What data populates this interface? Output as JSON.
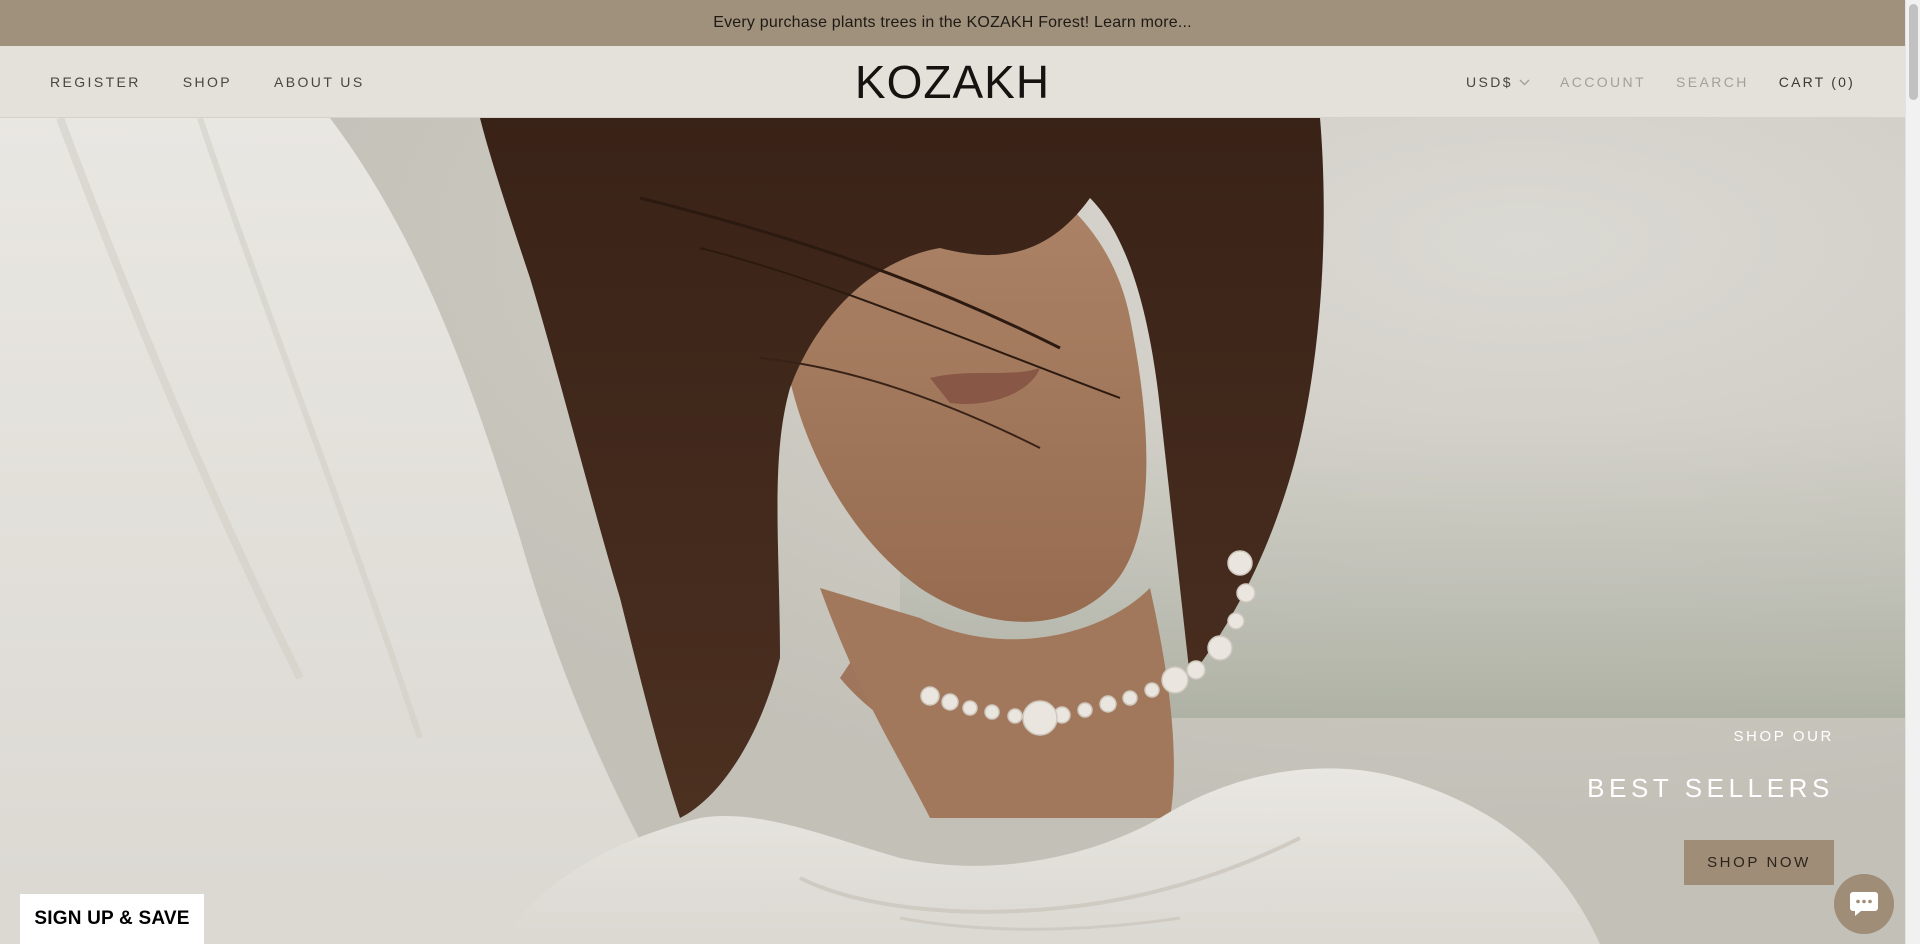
{
  "announcement": {
    "text": "Every purchase plants trees in the KOZAKH Forest! Learn more..."
  },
  "header": {
    "logo": "KOZAKH",
    "nav_left": [
      "REGISTER",
      "SHOP",
      "ABOUT US"
    ],
    "currency": "USD$",
    "account": "ACCOUNT",
    "search": "SEARCH",
    "cart": "CART (0)"
  },
  "hero": {
    "kicker": "SHOP OUR",
    "headline": "BEST SELLERS",
    "cta": "SHOP NOW"
  },
  "signup": {
    "label": "SIGN UP & SAVE"
  },
  "icons": {
    "currency_caret": "chevron-down-icon",
    "chat": "chat-bubble-icon"
  },
  "colors": {
    "announcement_bg": "#a0917c",
    "header_bg": "#e4e0da",
    "cta_bg": "#a08d77"
  }
}
